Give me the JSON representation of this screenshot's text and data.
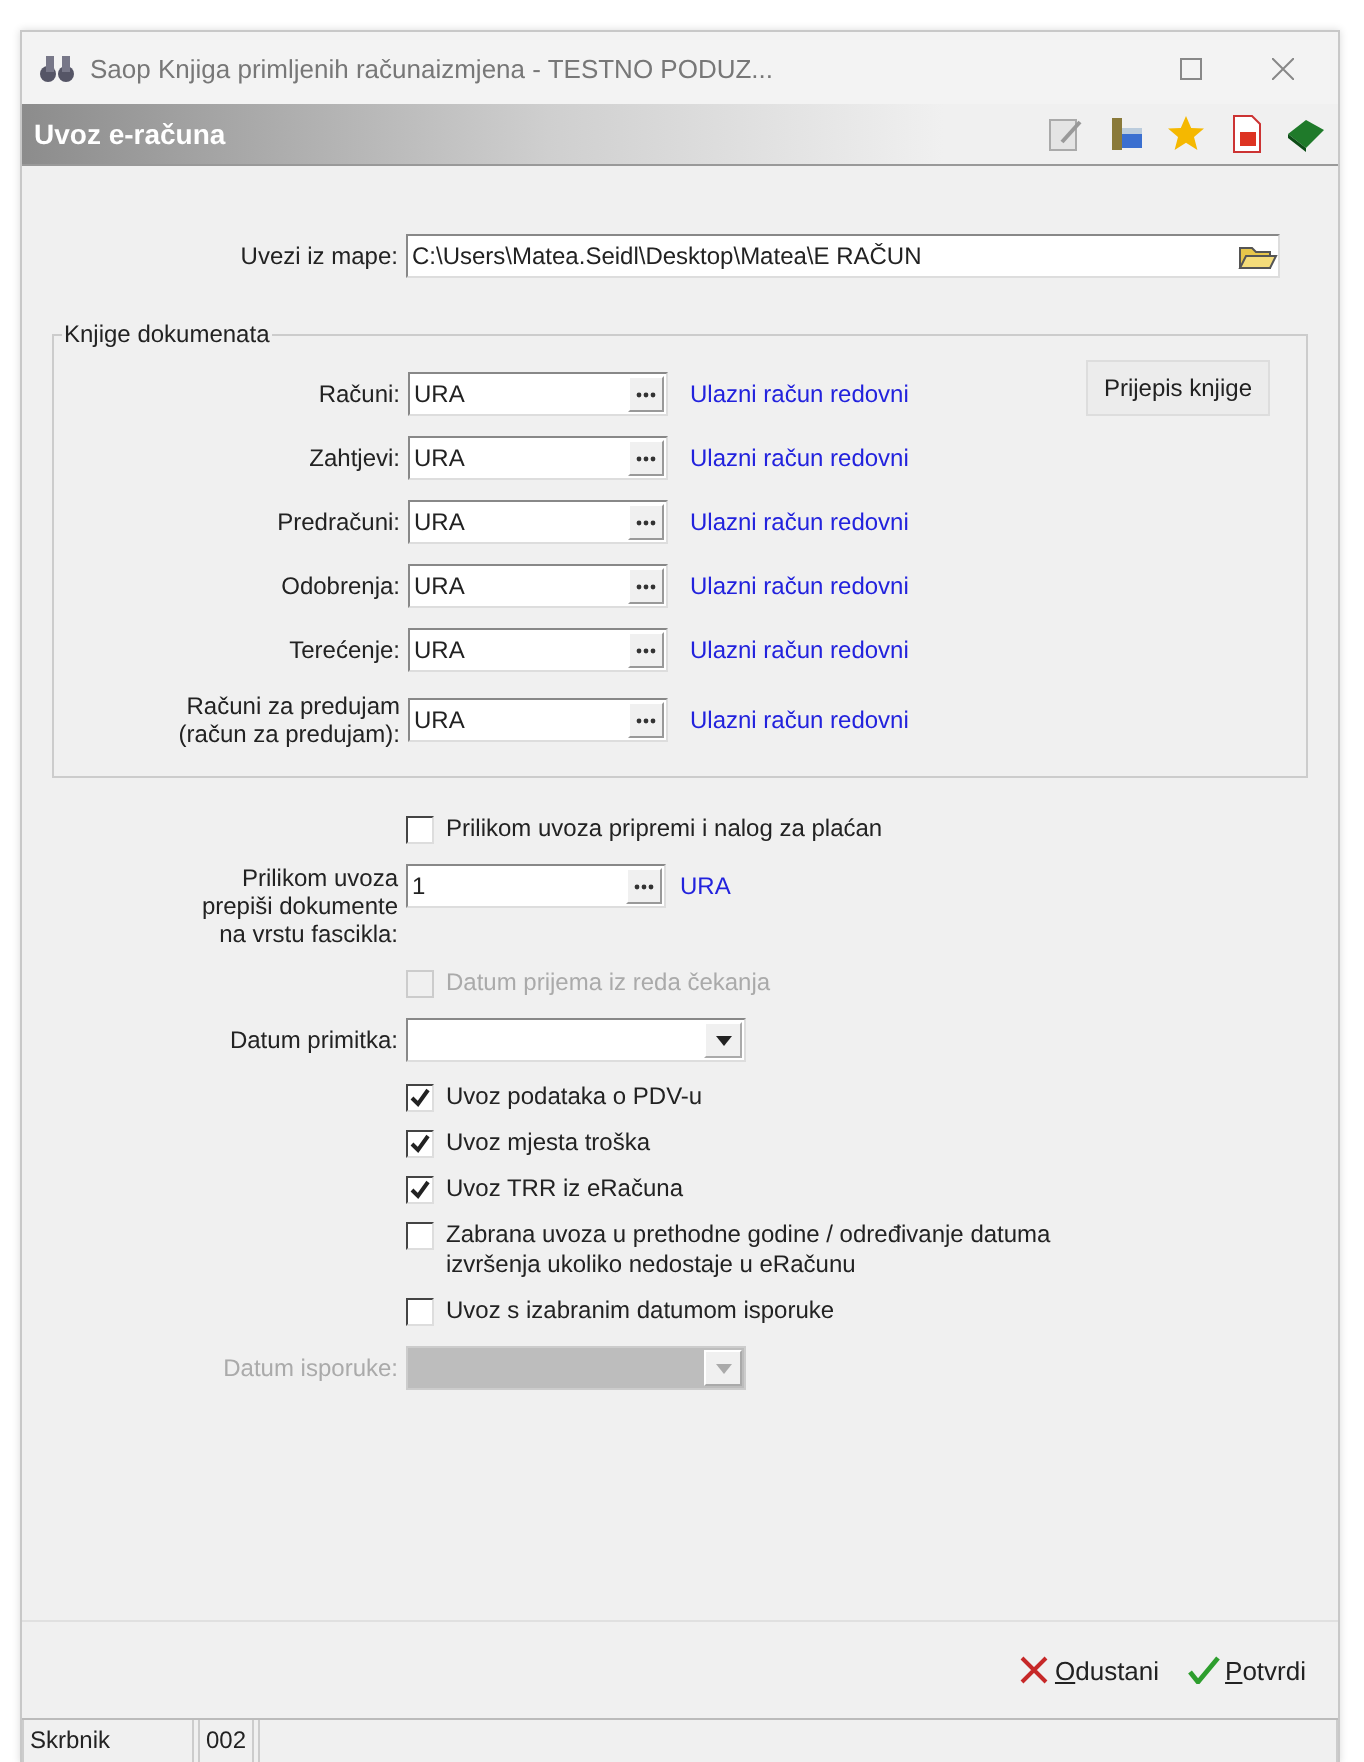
{
  "window": {
    "title": "Saop Knjiga primljenih računaizmjena  - TESTNO PODUZ..."
  },
  "header": {
    "title": "Uvoz e-računa"
  },
  "folder": {
    "label": "Uvezi iz mape:",
    "value": "C:\\Users\\Matea.Seidl\\Desktop\\Matea\\E RAČUN"
  },
  "books": {
    "title": "Knjige dokumenata",
    "button": "Prijepis knjige",
    "rows": [
      {
        "label": "Računi:",
        "value": "URA",
        "description": "Ulazni račun redovni"
      },
      {
        "label": "Zahtjevi:",
        "value": "URA",
        "description": "Ulazni račun redovni"
      },
      {
        "label": "Predračuni:",
        "value": "URA",
        "description": "Ulazni račun redovni"
      },
      {
        "label": "Odobrenja:",
        "value": "URA",
        "description": "Ulazni račun redovni"
      },
      {
        "label": "Terećenje:",
        "value": "URA",
        "description": "Ulazni račun redovni"
      },
      {
        "label": "Računi za predujam\n(račun za predujam):",
        "value": "URA",
        "description": "Ulazni račun redovni"
      }
    ]
  },
  "options": [
    {
      "kind": "checkbox",
      "label": "Prilikom uvoza pripremi i nalog za plaćan",
      "checked": false,
      "disabled": false
    },
    {
      "kind": "lookup",
      "label": "Prilikom uvoza\nprepiši dokumente\nna vrstu fascikla:",
      "value": "1",
      "description": "URA"
    },
    {
      "kind": "checkbox",
      "label": "Datum prijema iz reda čekanja",
      "checked": false,
      "disabled": true
    },
    {
      "kind": "dropdown",
      "label": "Datum primitka:",
      "disabled": false
    },
    {
      "kind": "checkbox",
      "label": "Uvoz podataka o PDV-u",
      "checked": true,
      "disabled": false
    },
    {
      "kind": "checkbox",
      "label": "Uvoz mjesta troška",
      "checked": true,
      "disabled": false
    },
    {
      "kind": "checkbox",
      "label": "Uvoz TRR iz eRačuna",
      "checked": true,
      "disabled": false
    },
    {
      "kind": "checkbox",
      "label": "Zabrana uvoza u prethodne godine / određivanje datuma\nizvršenja ukoliko nedostaje u eRačunu",
      "checked": false,
      "disabled": false
    },
    {
      "kind": "checkbox",
      "label": "Uvoz s izabranim datumom isporuke",
      "checked": false,
      "disabled": false
    },
    {
      "kind": "dropdown",
      "label": "Datum isporuke:",
      "disabled": true
    }
  ],
  "buttons": [
    {
      "kind": "cancel",
      "label": "Odustani"
    },
    {
      "kind": "confirm",
      "label": "Potvrdi"
    }
  ],
  "status_bar": [
    "Skrbnik",
    "002"
  ]
}
